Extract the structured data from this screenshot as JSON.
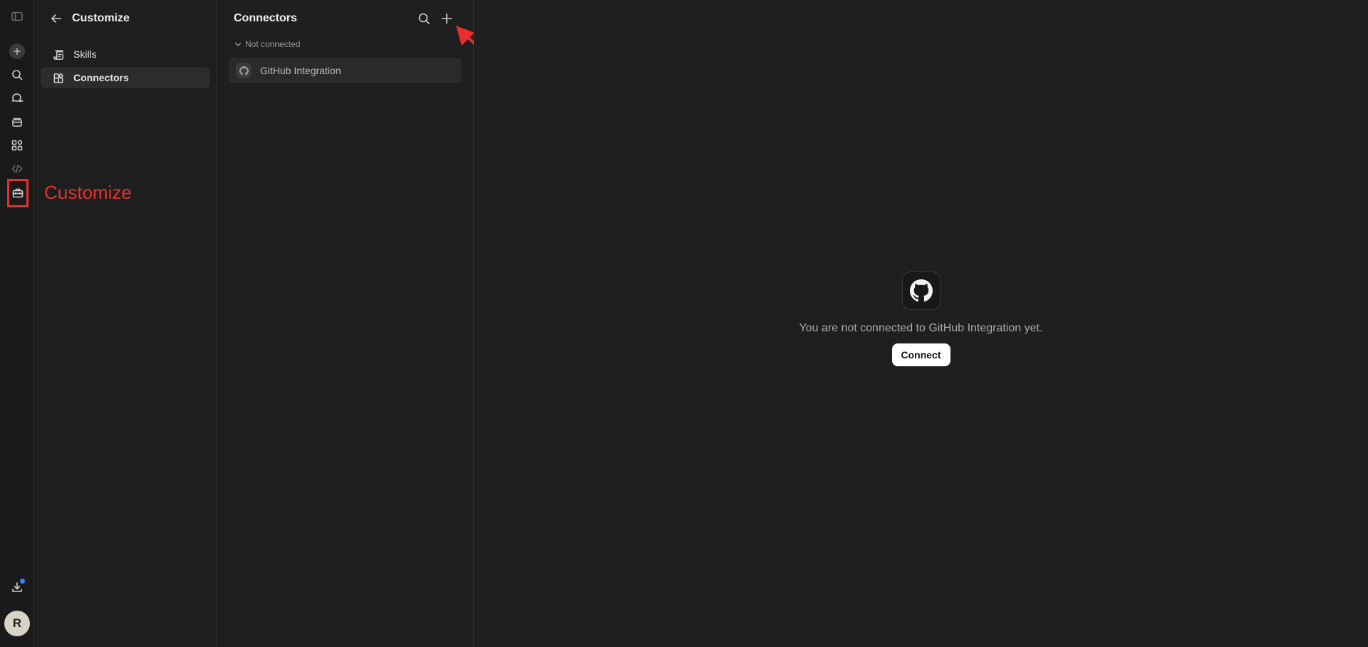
{
  "annotation": {
    "label": "Customize",
    "color": "#e8302a"
  },
  "rail": {
    "icons": [
      "sidebar-toggle-icon",
      "new-chat-icon",
      "search-icon",
      "chats-icon",
      "projects-icon",
      "artifacts-icon",
      "code-icon",
      "customize-icon",
      "download-icon"
    ],
    "avatar_initial": "R",
    "notification_color": "#2f86ff"
  },
  "sidebar": {
    "title": "Customize",
    "items": [
      {
        "label": "Skills",
        "icon": "skills-icon",
        "active": false
      },
      {
        "label": "Connectors",
        "icon": "connectors-icon",
        "active": true
      }
    ]
  },
  "connectors_pane": {
    "title": "Connectors",
    "group_label": "Not connected",
    "items": [
      {
        "name": "GitHub Integration",
        "icon": "github-icon"
      }
    ]
  },
  "detail": {
    "message": "You are not connected to GitHub Integration yet.",
    "connect_label": "Connect",
    "logo": "github-icon"
  }
}
